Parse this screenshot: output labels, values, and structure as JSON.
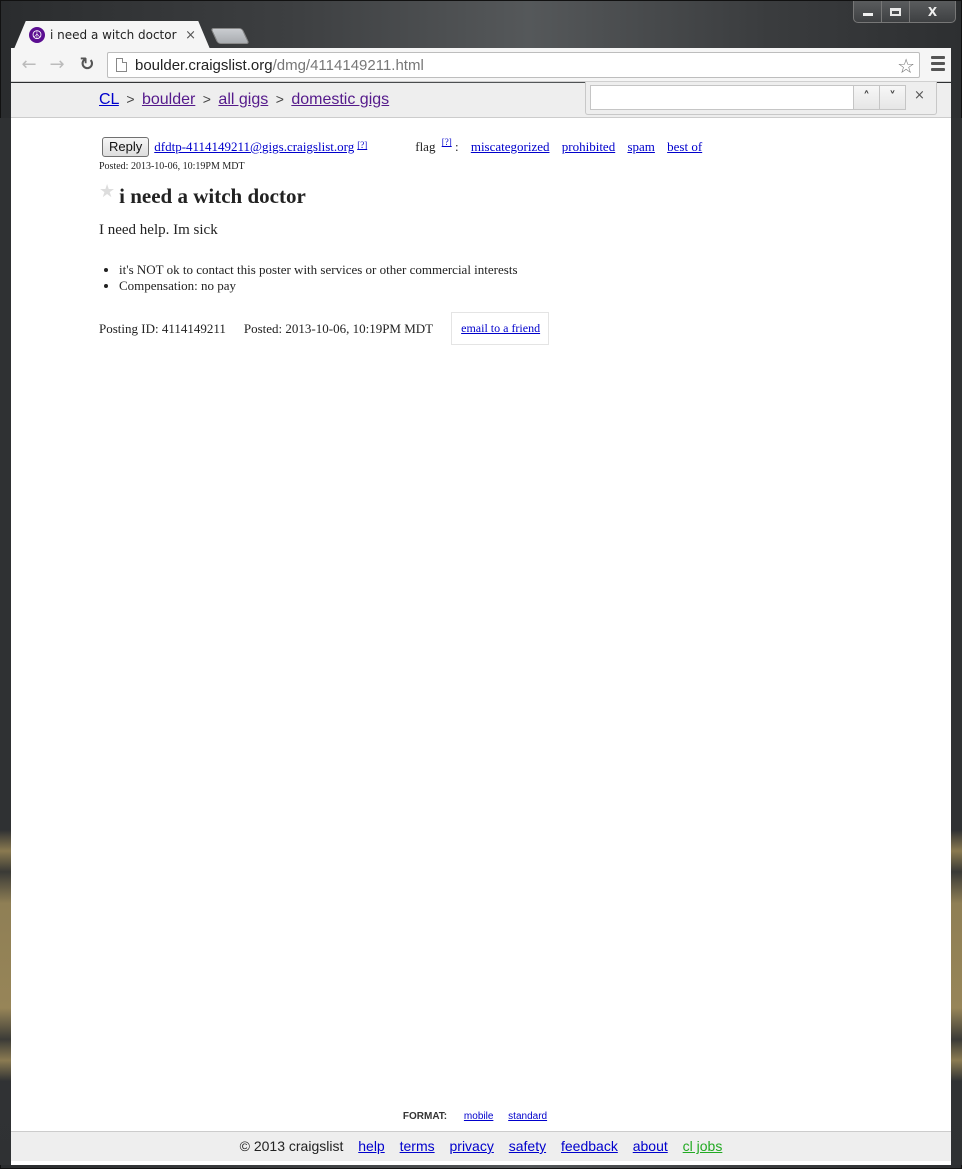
{
  "window": {
    "controls": {
      "minimize": "minimize",
      "maximize": "maximize",
      "close": "X"
    }
  },
  "tab": {
    "favicon": "☮",
    "title": "i need a witch doctor",
    "close": "×"
  },
  "toolbar": {
    "back": "←",
    "forward": "→",
    "reload": "C",
    "url_host": "boulder.craigslist.org",
    "url_path": "/dmg/4114149211.html",
    "bookmark_star": "☆"
  },
  "breadcrumbs": [
    {
      "label": "CL"
    },
    {
      "label": "boulder"
    },
    {
      "label": "all gigs"
    },
    {
      "label": "domestic gigs"
    }
  ],
  "breadcrumb_separator": ">",
  "findbar": {
    "value": "",
    "prev": "⌃",
    "next": "⌄",
    "close": "×"
  },
  "post": {
    "reply_label": "Reply",
    "reply_email": "dfdtp-4114149211@gigs.craigslist.org",
    "help_marker": "[?]",
    "flag_label": "flag",
    "flag_colon": ":",
    "flags": [
      "miscategorized",
      "prohibited",
      "spam",
      "best of"
    ],
    "posted_small": "Posted: 2013-10-06, 10:19PM MDT",
    "favorite_star": "★",
    "title": "i need a witch doctor",
    "body": "I need help. Im sick",
    "notices": [
      "it's NOT ok to contact this poster with services or other commercial interests",
      "Compensation: no pay"
    ],
    "posting_id": "Posting ID: 4114149211",
    "posted": "Posted: 2013-10-06, 10:19PM MDT",
    "email_friend": "email to a friend"
  },
  "format": {
    "label": "FORMAT:",
    "options": [
      "mobile",
      "standard"
    ]
  },
  "footer": {
    "copyright": "© 2013 craigslist",
    "links": [
      "help",
      "terms",
      "privacy",
      "safety",
      "feedback",
      "about"
    ],
    "jobs_link": "cl jobs",
    "jobs_color": "#22aa22"
  }
}
